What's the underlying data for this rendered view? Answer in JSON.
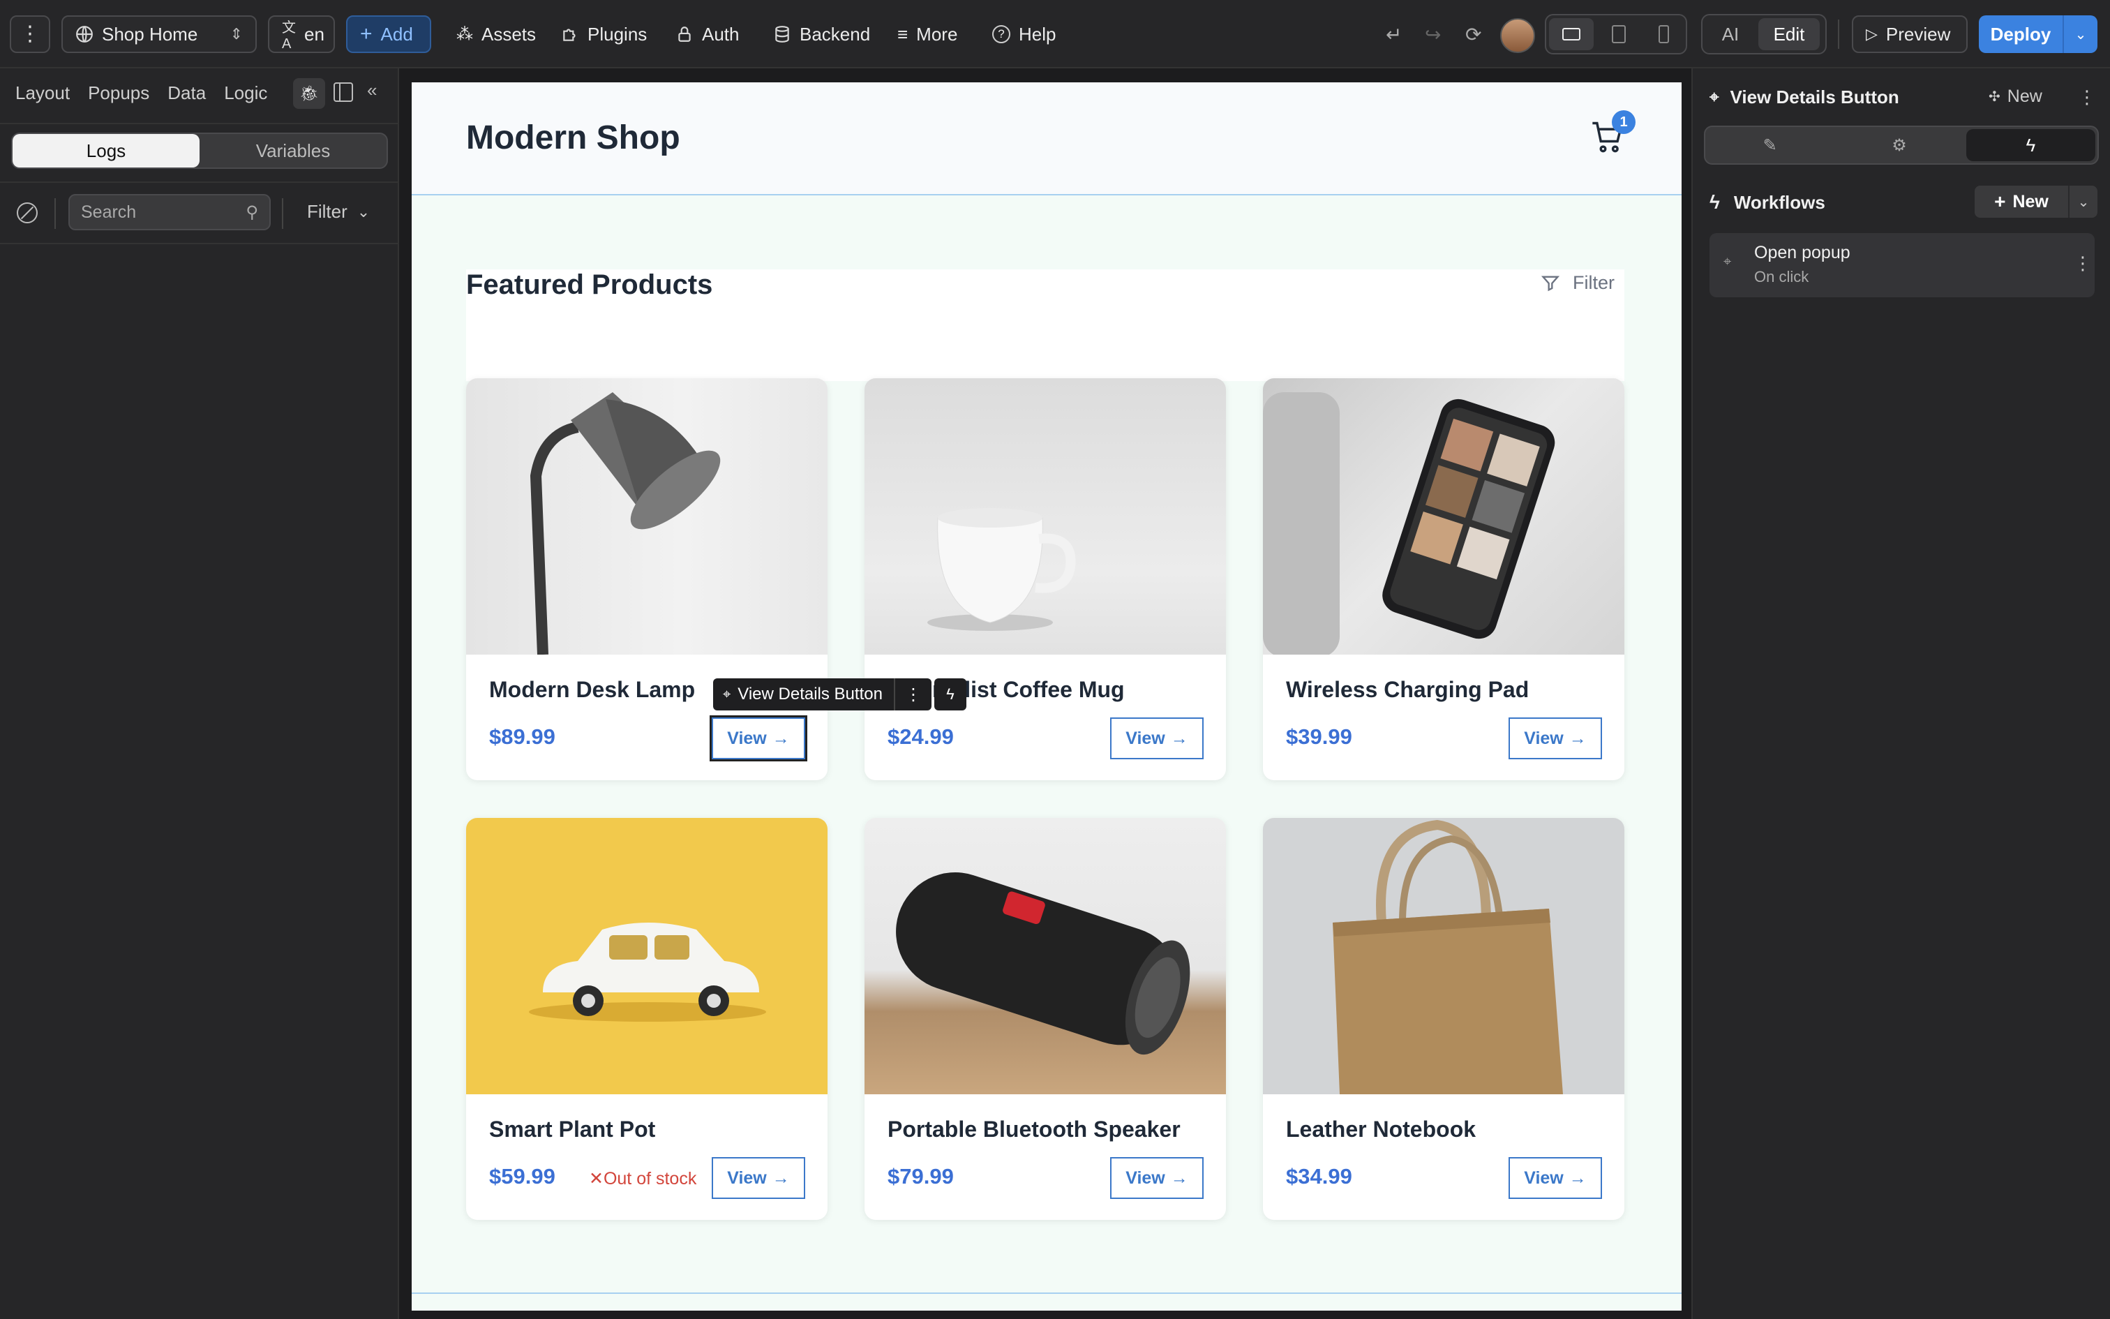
{
  "topbar": {
    "page_select": "Shop Home",
    "lang": "en",
    "add": "Add",
    "assets": "Assets",
    "plugins": "Plugins",
    "auth": "Auth",
    "backend": "Backend",
    "more": "More",
    "help": "Help",
    "ai": "AI",
    "edit": "Edit",
    "preview": "Preview",
    "deploy": "Deploy"
  },
  "left": {
    "tabs": [
      "Layout",
      "Popups",
      "Data",
      "Logic"
    ],
    "seg_logs": "Logs",
    "seg_variables": "Variables",
    "search_placeholder": "Search",
    "filter": "Filter"
  },
  "shop": {
    "title": "Modern Shop",
    "cart_count": "1",
    "section_title": "Featured Products",
    "filter": "Filter",
    "view_label": "View",
    "out_of_stock": "Out of stock",
    "selection_label": "View Details Button",
    "products": [
      {
        "name": "Modern Desk Lamp",
        "price": "$89.99"
      },
      {
        "name": "Minimalist Coffee Mug",
        "price": "$24.99"
      },
      {
        "name": "Wireless Charging Pad",
        "price": "$39.99"
      },
      {
        "name": "Smart Plant Pot",
        "price": "$59.99"
      },
      {
        "name": "Portable Bluetooth Speaker",
        "price": "$79.99"
      },
      {
        "name": "Leather Notebook",
        "price": "$34.99"
      }
    ]
  },
  "right": {
    "element_title": "View Details Button",
    "new": "New",
    "workflows": "Workflows",
    "workflow_new": "New",
    "workflow_name": "Open popup",
    "workflow_trigger": "On click"
  },
  "colors": {
    "accent": "#3b82f6",
    "deploy": "#3b82e0",
    "price": "#3b6fd4",
    "danger": "#d2453b"
  }
}
